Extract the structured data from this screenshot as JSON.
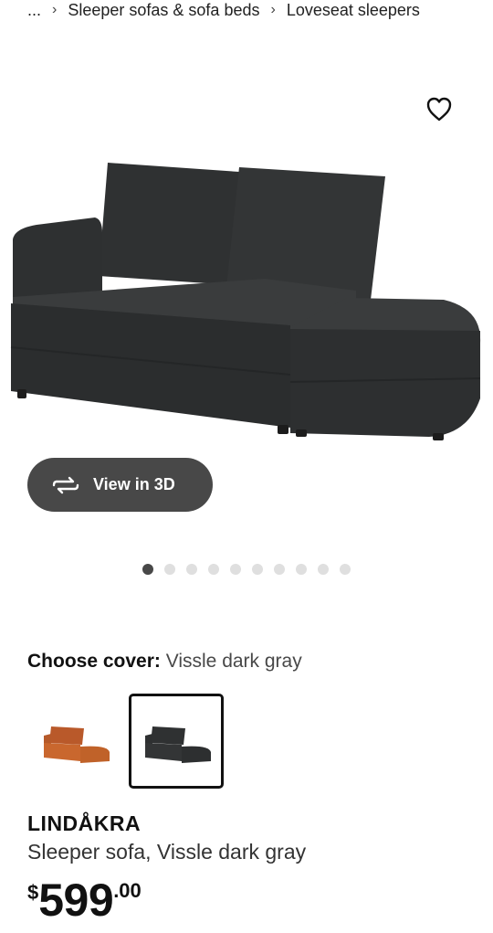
{
  "breadcrumb": {
    "ellipsis": "...",
    "items": [
      "Sleeper sofas & sofa beds",
      "Loveseat sleepers"
    ],
    "separator": "›"
  },
  "favorite": {
    "icon": "heart-outline-icon"
  },
  "media": {
    "view3d_label": "View in 3D",
    "view3d_icon": "rotate-3d-icon",
    "carousel_total": 10,
    "carousel_active": 1
  },
  "cover": {
    "label": "Choose cover:",
    "value": "Vissle dark gray",
    "options": [
      {
        "color": "#c9672e",
        "selected": false
      },
      {
        "color": "#333536",
        "selected": true
      }
    ]
  },
  "product": {
    "name": "LINDÅKRA",
    "description": "Sleeper sofa, Vissle dark gray"
  },
  "price": {
    "currency": "$",
    "integer": "599",
    "decimals": ".00"
  },
  "colors": {
    "sofa_dark": "#333536",
    "sofa_orange": "#c9672e",
    "button_bg": "#484848",
    "dot_inactive": "#dfdfdf"
  }
}
